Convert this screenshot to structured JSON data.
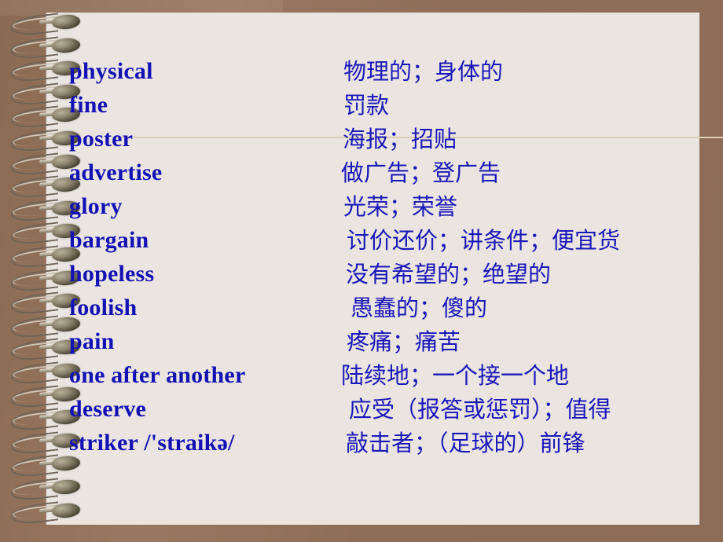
{
  "slide": {
    "title": "Vocabulary list on spiral notepad",
    "page_background": "#eae5e1",
    "frame_color": "#8f6e57",
    "text_color": "#1411b4",
    "rule_color": "#d9cfb2"
  },
  "binding": {
    "icon": "spiral-ring-icon",
    "ring_count": 22
  },
  "vocabulary": [
    {
      "english": "physical",
      "chinese": "物理的；身体的",
      "zh_indent": 437
    },
    {
      "english": "fine",
      "chinese": "罚款",
      "zh_indent": 437
    },
    {
      "english": "poster",
      "chinese": "海报；招贴",
      "zh_indent": 436
    },
    {
      "english": "advertise",
      "chinese": "做广告；登广告",
      "zh_indent": 434
    },
    {
      "english": "glory",
      "chinese": "光荣；荣誉",
      "zh_indent": 437
    },
    {
      "english": "bargain",
      "chinese": "讨价还价；讲条件；便宜货",
      "zh_indent": 441
    },
    {
      "english": "hopeless",
      "chinese": "没有希望的；绝望的",
      "zh_indent": 440
    },
    {
      "english": "foolish",
      "chinese": "愚蠢的；傻的",
      "zh_indent": 446
    },
    {
      "english": "pain",
      "chinese": "疼痛；痛苦",
      "zh_indent": 441
    },
    {
      "english": "one after another",
      "chinese": "陆续地；一个接一个地",
      "zh_indent": 434
    },
    {
      "english": "deserve",
      "chinese": "应受（报答或惩罚）；值得",
      "zh_indent": 444
    },
    {
      "english": "striker  /'straikə/",
      "chinese": "敲击者；（足球的）前锋",
      "zh_indent": 440
    }
  ]
}
